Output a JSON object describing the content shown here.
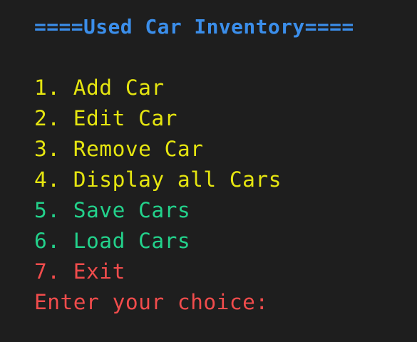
{
  "colors": {
    "background": "#1e1e1e",
    "title": "#3b8eea",
    "primary_option": "#e5e510",
    "save_load_option": "#0dbc79",
    "exit_option": "#cd3131"
  },
  "title": "====Used Car Inventory====",
  "menu": [
    {
      "label": "1. Add Car",
      "color": "#e5e510"
    },
    {
      "label": "2. Edit Car",
      "color": "#e5e510"
    },
    {
      "label": "3. Remove Car",
      "color": "#e5e510"
    },
    {
      "label": "4. Display all Cars",
      "color": "#e5e510"
    },
    {
      "label": "5. Save Cars",
      "color": "#23d18b"
    },
    {
      "label": "6. Load Cars",
      "color": "#23d18b"
    },
    {
      "label": "7. Exit",
      "color": "#f14c4c"
    }
  ],
  "prompt": {
    "text": "Enter your choice:",
    "color": "#f14c4c"
  }
}
